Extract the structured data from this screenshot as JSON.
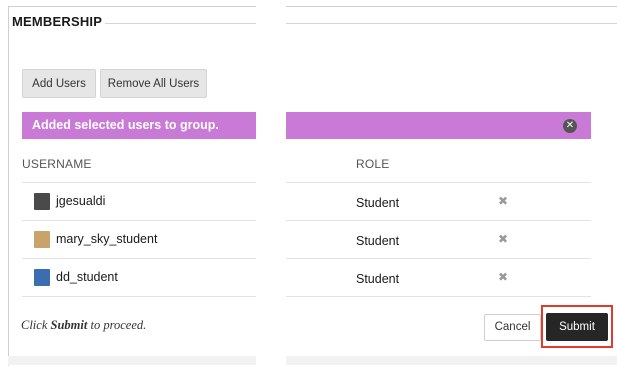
{
  "section": {
    "title": "MEMBERSHIP"
  },
  "toolbar": {
    "add_users_label": "Add Users",
    "remove_all_label": "Remove All Users"
  },
  "banner": {
    "message": "Added selected users to group.",
    "color": "#c97ad6",
    "close_icon": "close-circle-icon"
  },
  "table": {
    "headers": {
      "username": "USERNAME",
      "role": "ROLE"
    },
    "rows": [
      {
        "username": "jgesualdi",
        "role": "Student",
        "remove_icon": "✖",
        "avatar_color": "#4a4a4a"
      },
      {
        "username": "mary_sky_student",
        "role": "Student",
        "remove_icon": "✖",
        "avatar_color": "#c8a46a"
      },
      {
        "username": "dd_student",
        "role": "Student",
        "remove_icon": "✖",
        "avatar_color": "#3b6db0"
      }
    ]
  },
  "footer": {
    "proceed_prefix": "Click ",
    "proceed_bold": "Submit",
    "proceed_suffix": " to proceed.",
    "cancel_label": "Cancel",
    "submit_label": "Submit",
    "highlight_color": "#e03c2d"
  }
}
